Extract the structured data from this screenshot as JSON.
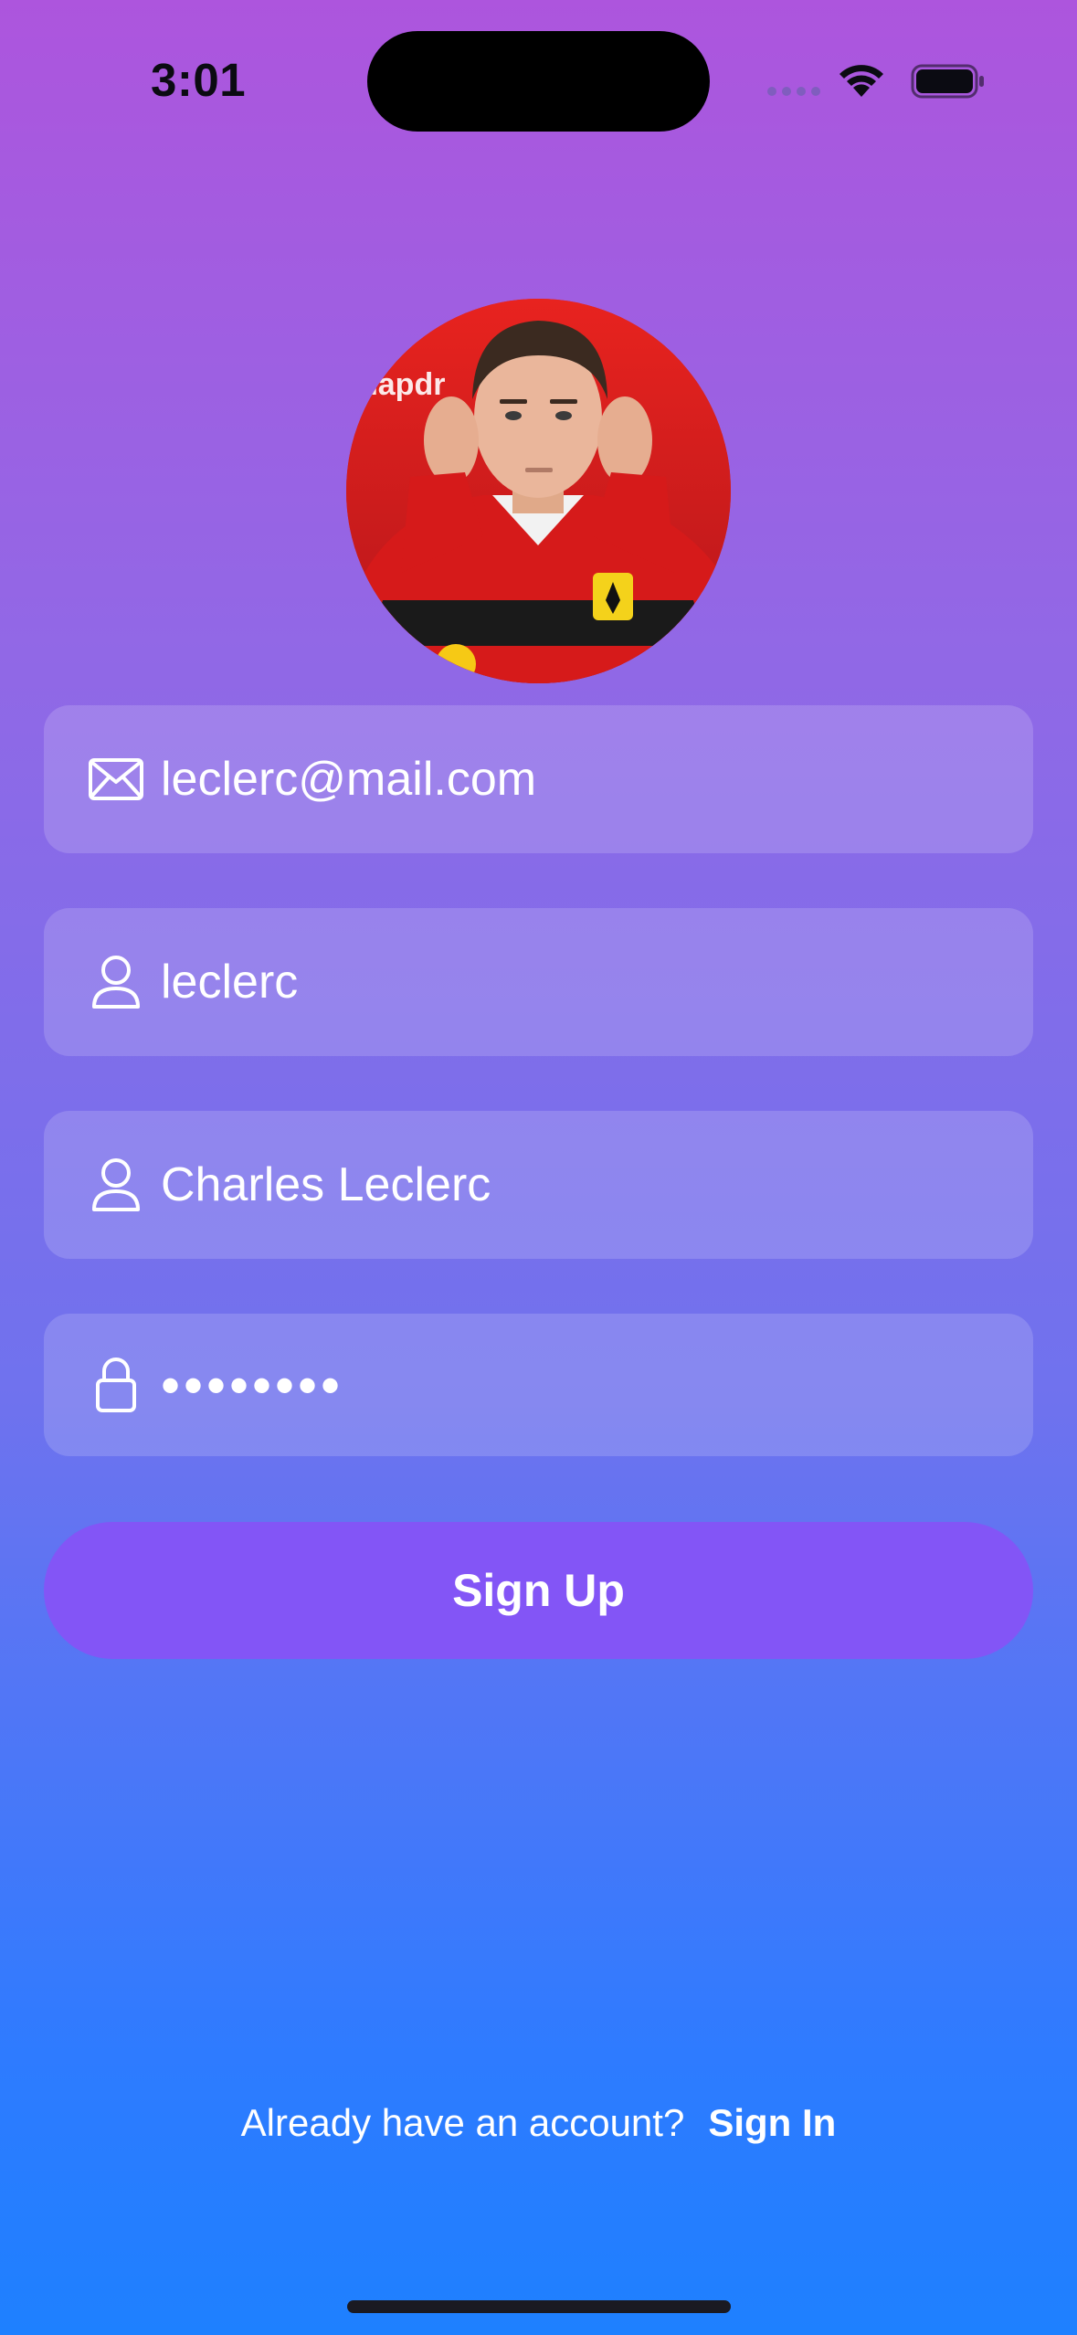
{
  "status_bar": {
    "time": "3:01"
  },
  "form": {
    "email": {
      "value": "leclerc@mail.com",
      "icon": "envelope-icon"
    },
    "username": {
      "value": "leclerc",
      "icon": "person-icon"
    },
    "full_name": {
      "value": "Charles Leclerc",
      "icon": "person-icon"
    },
    "password": {
      "value": "••••••••",
      "icon": "lock-icon"
    }
  },
  "signup_button": {
    "label": "Sign Up"
  },
  "footer": {
    "prompt": "Already have an account?",
    "signin_label": "Sign In"
  },
  "colors": {
    "gradient_top": "#ad55dd",
    "gradient_bottom": "#1e80ff",
    "button": "#8355f6",
    "field": "rgba(255,255,255,0.16)"
  }
}
